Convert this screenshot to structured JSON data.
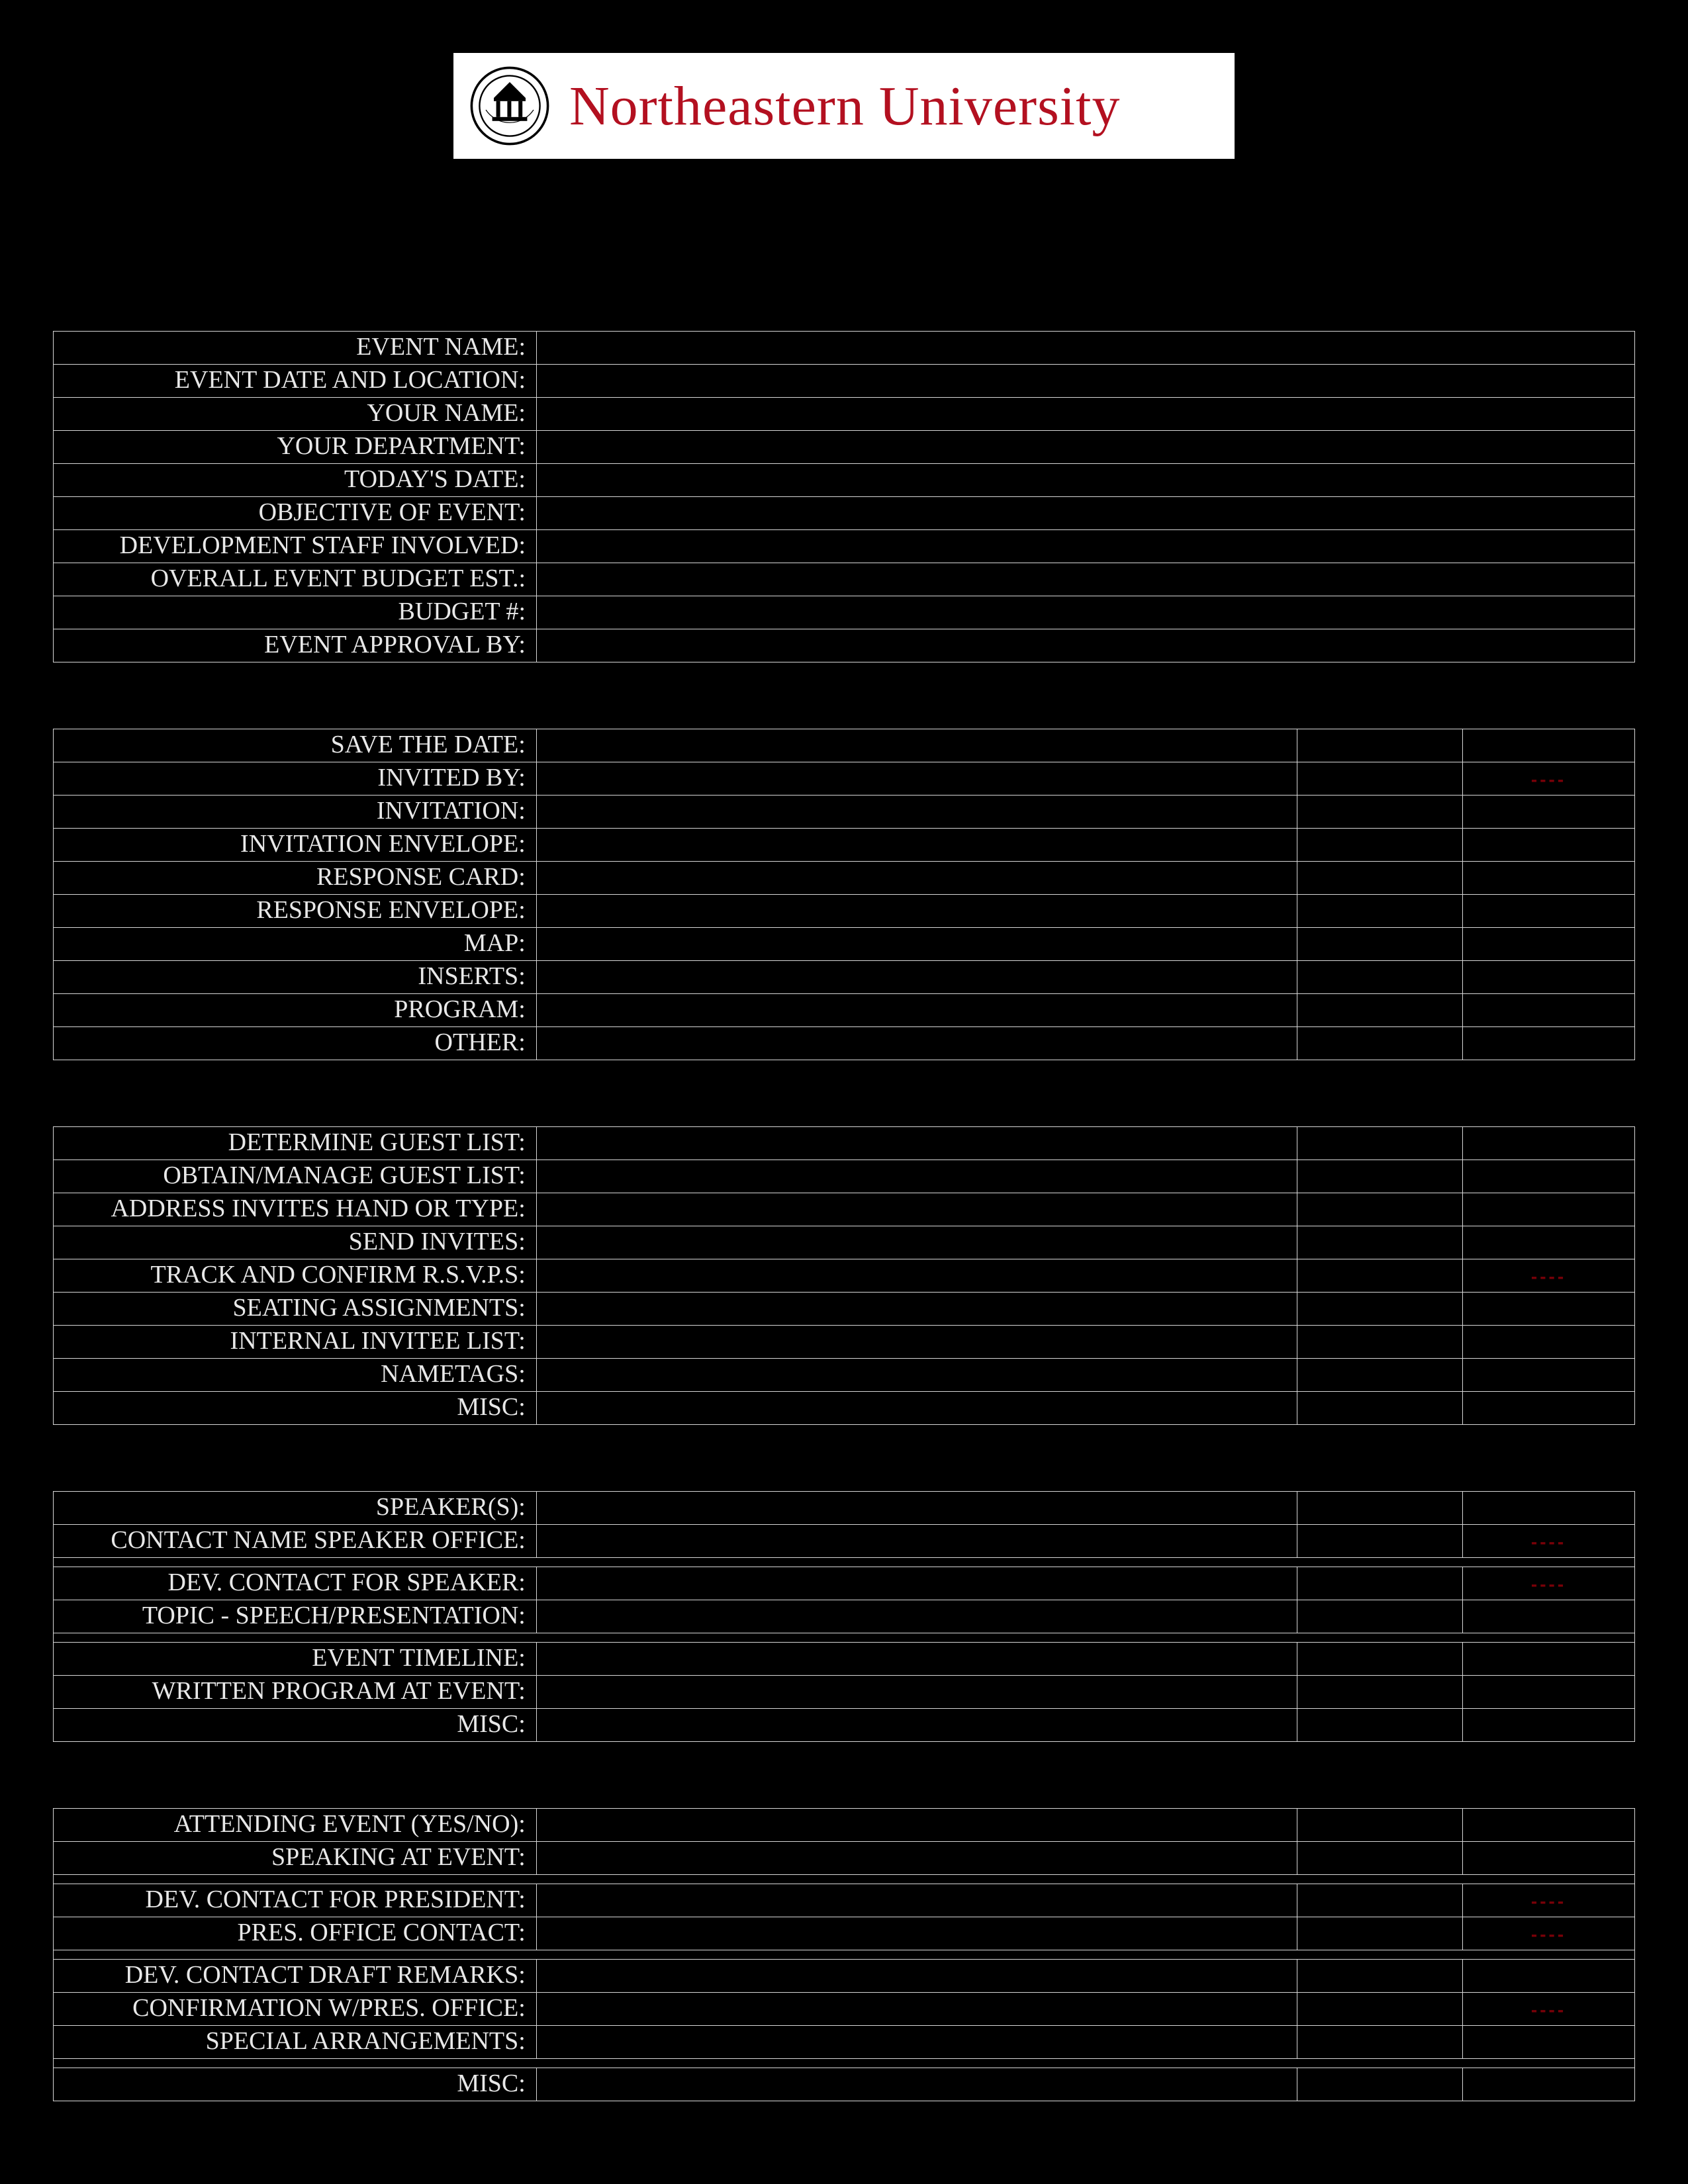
{
  "header": {
    "university_name": "Northeastern University"
  },
  "sections": {
    "event_info": {
      "rows": [
        {
          "label": "EVENT NAME:",
          "value": ""
        },
        {
          "label": "EVENT DATE AND LOCATION:",
          "value": ""
        },
        {
          "label": "YOUR NAME:",
          "value": ""
        },
        {
          "label": "YOUR DEPARTMENT:",
          "value": ""
        },
        {
          "label": "TODAY'S DATE:",
          "value": ""
        },
        {
          "label": "OBJECTIVE OF EVENT:",
          "value": ""
        },
        {
          "label": "DEVELOPMENT STAFF INVOLVED:",
          "value": ""
        },
        {
          "label": "OVERALL EVENT BUDGET EST.:",
          "value": ""
        },
        {
          "label": "BUDGET #:",
          "value": ""
        },
        {
          "label": "EVENT APPROVAL BY:",
          "value": ""
        }
      ]
    },
    "mailing": {
      "rows": [
        {
          "label": "SAVE THE DATE:",
          "value": "",
          "c3": "",
          "c4": ""
        },
        {
          "label": "INVITED BY:",
          "value": "",
          "c3": "",
          "c4": "----"
        },
        {
          "label": "INVITATION:",
          "value": "",
          "c3": "",
          "c4": ""
        },
        {
          "label": "INVITATION ENVELOPE:",
          "value": "",
          "c3": "",
          "c4": ""
        },
        {
          "label": "RESPONSE CARD:",
          "value": "",
          "c3": "",
          "c4": ""
        },
        {
          "label": "RESPONSE ENVELOPE:",
          "value": "",
          "c3": "",
          "c4": ""
        },
        {
          "label": "MAP:",
          "value": "",
          "c3": "",
          "c4": ""
        },
        {
          "label": "INSERTS:",
          "value": "",
          "c3": "",
          "c4": ""
        },
        {
          "label": "PROGRAM:",
          "value": "",
          "c3": "",
          "c4": ""
        },
        {
          "label": "OTHER:",
          "value": "",
          "c3": "",
          "c4": ""
        }
      ]
    },
    "guests": {
      "rows": [
        {
          "label": "DETERMINE GUEST LIST:",
          "value": "",
          "c3": "",
          "c4": ""
        },
        {
          "label": "OBTAIN/MANAGE GUEST LIST:",
          "value": "",
          "c3": "",
          "c4": ""
        },
        {
          "label": "ADDRESS INVITES HAND OR TYPE:",
          "value": "",
          "c3": "",
          "c4": ""
        },
        {
          "label": "SEND INVITES:",
          "value": "",
          "c3": "",
          "c4": ""
        },
        {
          "label": "TRACK AND CONFIRM R.S.V.P.S:",
          "value": "",
          "c3": "",
          "c4": "----"
        },
        {
          "label": "SEATING ASSIGNMENTS:",
          "value": "",
          "c3": "",
          "c4": ""
        },
        {
          "label": "INTERNAL INVITEE LIST:",
          "value": "",
          "c3": "",
          "c4": ""
        },
        {
          "label": "NAMETAGS:",
          "value": "",
          "c3": "",
          "c4": ""
        },
        {
          "label": "MISC:",
          "value": "",
          "c3": "",
          "c4": ""
        }
      ]
    },
    "speakers": {
      "rows": [
        {
          "label": "SPEAKER(S):",
          "value": "",
          "c3": "",
          "c4": "",
          "spacer_after": false
        },
        {
          "label": "CONTACT NAME SPEAKER OFFICE:",
          "value": "",
          "c3": "",
          "c4": "----",
          "spacer_after": true
        },
        {
          "label": "DEV. CONTACT FOR SPEAKER:",
          "value": "",
          "c3": "",
          "c4": "----",
          "spacer_after": false
        },
        {
          "label": "TOPIC - SPEECH/PRESENTATION:",
          "value": "",
          "c3": "",
          "c4": "",
          "spacer_after": true
        },
        {
          "label": "EVENT TIMELINE:",
          "value": "",
          "c3": "",
          "c4": "",
          "spacer_after": false
        },
        {
          "label": "WRITTEN PROGRAM AT EVENT:",
          "value": "",
          "c3": "",
          "c4": "",
          "spacer_after": false
        },
        {
          "label": "MISC:",
          "value": "",
          "c3": "",
          "c4": "",
          "spacer_after": false
        }
      ]
    },
    "president": {
      "rows": [
        {
          "label": "ATTENDING EVENT (YES/NO):",
          "value": "",
          "c3": "",
          "c4": "",
          "spacer_after": false
        },
        {
          "label": "SPEAKING AT EVENT:",
          "value": "",
          "c3": "",
          "c4": "",
          "spacer_after": true
        },
        {
          "label": "DEV. CONTACT FOR PRESIDENT:",
          "value": "",
          "c3": "",
          "c4": "----",
          "spacer_after": false
        },
        {
          "label": "PRES. OFFICE CONTACT:",
          "value": "",
          "c3": "",
          "c4": "----",
          "spacer_after": true
        },
        {
          "label": "DEV. CONTACT DRAFT REMARKS:",
          "value": "",
          "c3": "",
          "c4": "",
          "spacer_after": false
        },
        {
          "label": "CONFIRMATION W/PRES. OFFICE:",
          "value": "",
          "c3": "",
          "c4": "----",
          "spacer_after": false
        },
        {
          "label": "SPECIAL ARRANGEMENTS:",
          "value": "",
          "c3": "",
          "c4": "",
          "spacer_after": true
        },
        {
          "label": "MISC:",
          "value": "",
          "c3": "",
          "c4": "",
          "spacer_after": false
        }
      ]
    }
  }
}
